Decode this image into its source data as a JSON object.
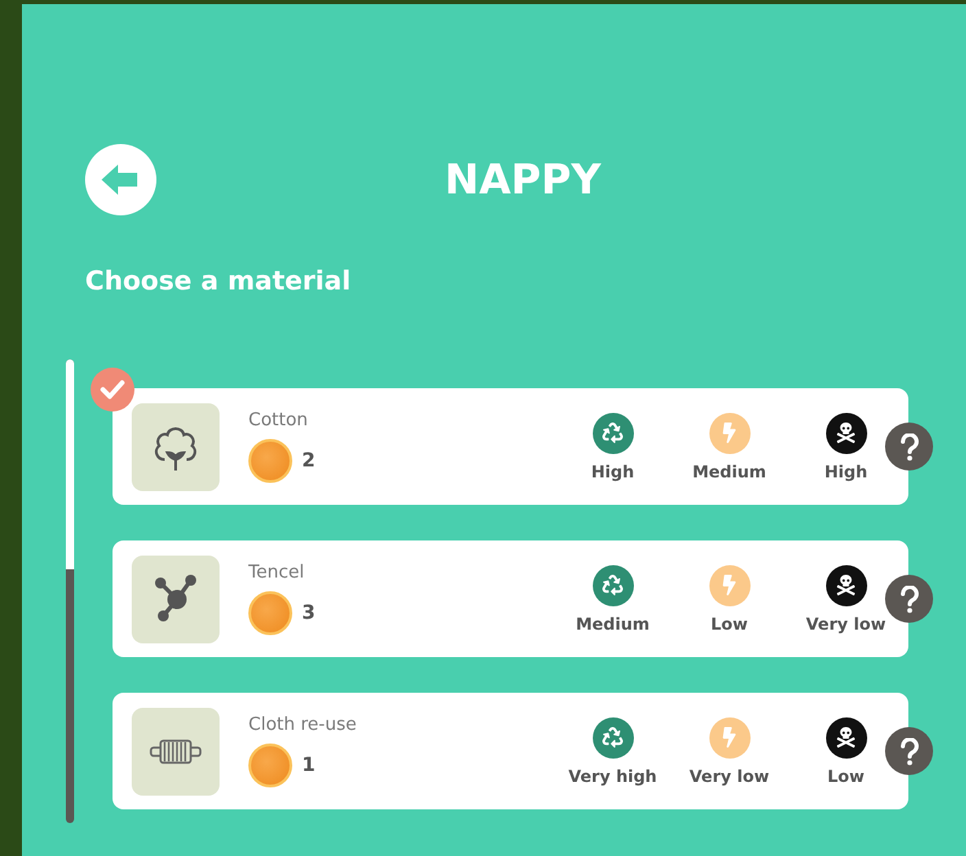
{
  "header": {
    "title": "NAPPY"
  },
  "subtitle": "Choose a material",
  "materials": [
    {
      "kind": "cotton",
      "name": "Cotton",
      "cost": "2",
      "selected": true,
      "ratings": [
        {
          "kind": "recycle",
          "label": "High"
        },
        {
          "kind": "energy",
          "label": "Medium"
        },
        {
          "kind": "toxicity",
          "label": "High"
        }
      ]
    },
    {
      "kind": "tencel",
      "name": "Tencel",
      "cost": "3",
      "selected": false,
      "ratings": [
        {
          "kind": "recycle",
          "label": "Medium"
        },
        {
          "kind": "energy",
          "label": "Low"
        },
        {
          "kind": "toxicity",
          "label": "Very low"
        }
      ]
    },
    {
      "kind": "cloth",
      "name": "Cloth re-use",
      "cost": "1",
      "selected": false,
      "ratings": [
        {
          "kind": "recycle",
          "label": "Very high"
        },
        {
          "kind": "energy",
          "label": "Very low"
        },
        {
          "kind": "toxicity",
          "label": "Low"
        }
      ]
    }
  ]
}
